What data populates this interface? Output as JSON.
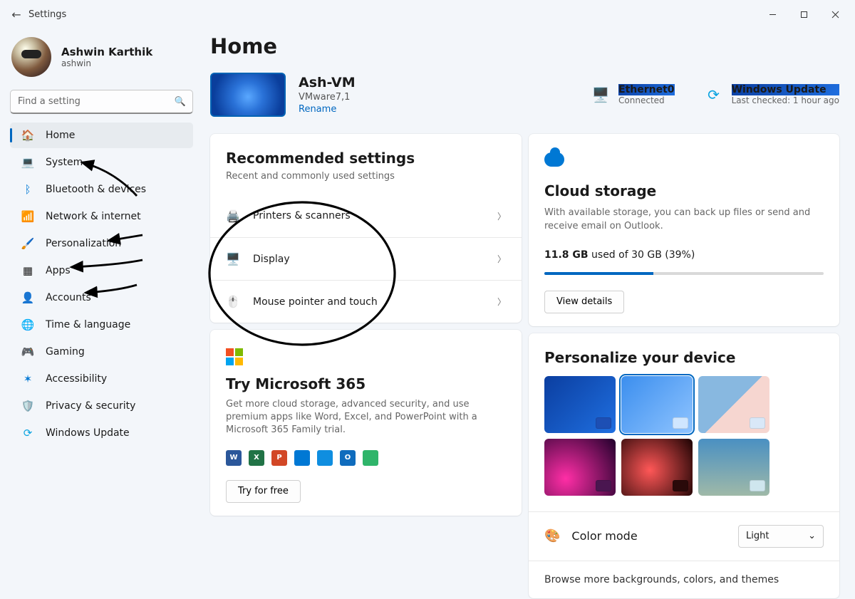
{
  "window": {
    "title": "Settings"
  },
  "user": {
    "name": "Ashwin Karthik",
    "username": "ashwin"
  },
  "search": {
    "placeholder": "Find a setting"
  },
  "nav": {
    "items": [
      {
        "label": "Home",
        "icon": "🏠",
        "active": true
      },
      {
        "label": "System",
        "icon": "💻"
      },
      {
        "label": "Bluetooth & devices",
        "icon": "ᛒ",
        "iconColor": "#0078d4"
      },
      {
        "label": "Network & internet",
        "icon": "📶",
        "iconColor": "#0aa3e0"
      },
      {
        "label": "Personalization",
        "icon": "🖌️"
      },
      {
        "label": "Apps",
        "icon": "▦"
      },
      {
        "label": "Accounts",
        "icon": "👤",
        "iconColor": "#28a745"
      },
      {
        "label": "Time & language",
        "icon": "🌐"
      },
      {
        "label": "Gaming",
        "icon": "🎮"
      },
      {
        "label": "Accessibility",
        "icon": "✶",
        "iconColor": "#0078d4"
      },
      {
        "label": "Privacy & security",
        "icon": "🛡️"
      },
      {
        "label": "Windows Update",
        "icon": "⟳",
        "iconColor": "#0aa3e0"
      }
    ]
  },
  "page": {
    "title": "Home"
  },
  "device": {
    "name": "Ash-VM",
    "model": "VMware7,1",
    "rename": "Rename"
  },
  "header_status": {
    "network": {
      "title": "Ethernet0",
      "sub": "Connected"
    },
    "update": {
      "title": "Windows Update",
      "sub": "Last checked: 1 hour ago"
    }
  },
  "recommended": {
    "title": "Recommended settings",
    "subtitle": "Recent and commonly used settings",
    "items": [
      {
        "label": "Printers & scanners",
        "icon": "printer-icon"
      },
      {
        "label": "Display",
        "icon": "display-icon"
      },
      {
        "label": "Mouse pointer and touch",
        "icon": "pointer-icon"
      }
    ]
  },
  "m365": {
    "title": "Try Microsoft 365",
    "desc": "Get more cloud storage, advanced security, and use premium apps like Word, Excel, and PowerPoint with a Microsoft 365 Family trial.",
    "cta": "Try for free",
    "apps": [
      {
        "name": "Word",
        "letter": "W",
        "color": "#2b579a"
      },
      {
        "name": "Excel",
        "letter": "X",
        "color": "#217346"
      },
      {
        "name": "PowerPoint",
        "letter": "P",
        "color": "#d24726"
      },
      {
        "name": "Defender",
        "letter": "",
        "color": "#0078d4"
      },
      {
        "name": "OneDrive",
        "letter": "",
        "color": "#0f8ee0"
      },
      {
        "name": "Outlook",
        "letter": "O",
        "color": "#0f6cbd"
      },
      {
        "name": "FamilySafety",
        "letter": "",
        "color": "#2fb56a"
      }
    ]
  },
  "cloud": {
    "title": "Cloud storage",
    "desc": "With available storage, you can back up files or send and receive email on Outlook.",
    "used_gb": "11.8 GB",
    "used_rest": " used of 30 GB (39%)",
    "percent": 39,
    "cta": "View details"
  },
  "personalize": {
    "title": "Personalize your device",
    "selected_index": 1,
    "color_mode_label": "Color mode",
    "color_mode_value": "Light",
    "browse_label": "Browse more backgrounds, colors, and themes"
  }
}
